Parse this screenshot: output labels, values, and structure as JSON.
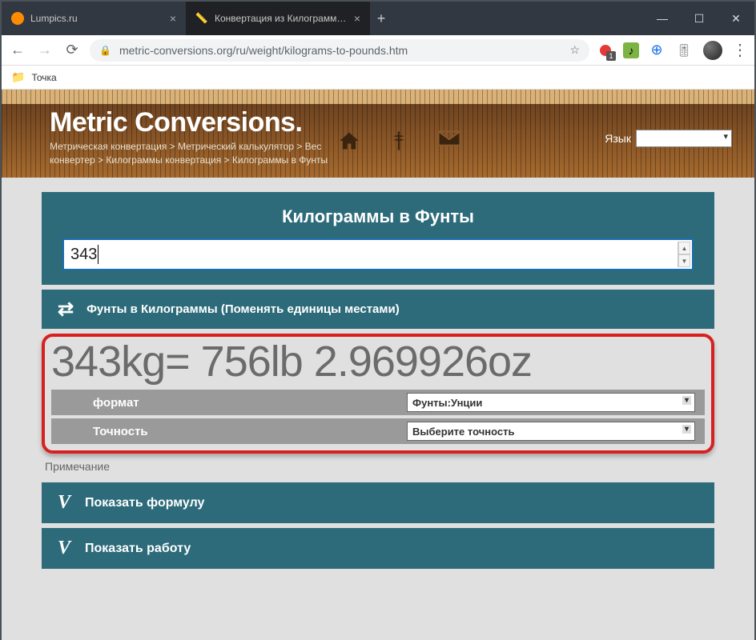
{
  "window": {
    "tabs": [
      {
        "title": "Lumpics.ru",
        "active": false
      },
      {
        "title": "Конвертация из Килограммы в",
        "active": true
      }
    ],
    "bookmarks": {
      "item1": "Точка"
    }
  },
  "address": {
    "url": "metric-conversions.org/ru/weight/kilograms-to-pounds.htm"
  },
  "extensions": {
    "badge": "1"
  },
  "site": {
    "title": "Metric Conversions.",
    "breadcrumb": "Метрическая конвертация > Метрический калькулятор > Вес конвертер > Килограммы конвертация > Килограммы в Фунты",
    "lang_label": "Язык"
  },
  "converter": {
    "title": "Килограммы в Фунты",
    "input_value": "343",
    "swap_label": "Фунты в Килограммы (Поменять единицы местами)",
    "result_text": "343kg= 756lb 2.969926oz",
    "format_label": "формат",
    "format_value": "Фунты:Унции",
    "accuracy_label": "Точность",
    "accuracy_value": "Выберите точность",
    "note": "Примечание",
    "show_formula": "Показать формулу",
    "show_work": "Показать работу"
  }
}
